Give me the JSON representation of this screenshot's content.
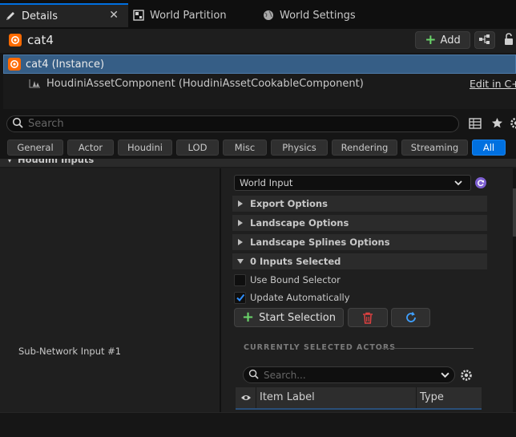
{
  "tabs": [
    {
      "label": "Details",
      "icon": "pencil-icon",
      "active": true
    },
    {
      "label": "World Partition",
      "icon": "grid-icon",
      "active": false
    },
    {
      "label": "World Settings",
      "icon": "globe-icon",
      "active": false
    }
  ],
  "tab_close": "✕",
  "title": "cat4",
  "add_label": "Add",
  "tree": {
    "instance": "cat4 (Instance)",
    "component": "HoudiniAssetComponent (HoudiniAssetCookableComponent)",
    "edit_link": "Edit in C++"
  },
  "search": {
    "placeholder": "Search"
  },
  "filters": [
    "General",
    "Actor",
    "Houdini",
    "LOD",
    "Misc",
    "Physics",
    "Rendering",
    "Streaming",
    "All"
  ],
  "active_filter": "All",
  "section_header": "Houdini Inputs",
  "input_label": "Sub-Network Input #1",
  "input_type": "World Input",
  "sections": [
    {
      "label": "Export Options",
      "expanded": false
    },
    {
      "label": "Landscape Options",
      "expanded": false
    },
    {
      "label": "Landscape Splines Options",
      "expanded": false
    },
    {
      "label": "0 Inputs Selected",
      "expanded": true
    }
  ],
  "checks": [
    {
      "label": "Use Bound Selector",
      "checked": false
    },
    {
      "label": "Update Automatically",
      "checked": true
    }
  ],
  "start_selection": "Start Selection",
  "selected_header": "CURRENTLY SELECTED ACTORS",
  "actor_search": {
    "placeholder": "Search..."
  },
  "table_columns": [
    "Item Label",
    "Type"
  ],
  "colors": {
    "accent": "#0070e0",
    "selection": "#365e86",
    "houdini": "#ff6a00",
    "add": "#6ad46a",
    "delete": "#e04040",
    "refresh": "#3fa0ff"
  }
}
